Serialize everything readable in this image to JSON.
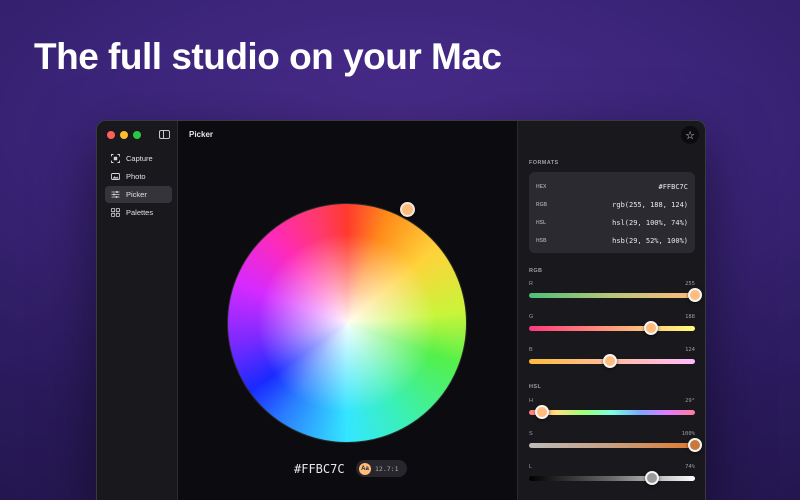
{
  "headline": "The full studio on your Mac",
  "sidebar": {
    "items": [
      {
        "label": "Capture",
        "icon": "capture-icon"
      },
      {
        "label": "Photo",
        "icon": "photo-icon"
      },
      {
        "label": "Picker",
        "icon": "sliders-icon",
        "active": true
      },
      {
        "label": "Palettes",
        "icon": "grid-icon"
      }
    ]
  },
  "main": {
    "title": "Picker",
    "hex": "#FFBC7C",
    "contrast_badge": "Aa",
    "contrast_ratio": "12.7:1",
    "selected_color": "#FFBC7C"
  },
  "panel": {
    "formats_label": "FORMATS",
    "formats": [
      {
        "key": "HEX",
        "value": "#FFBC7C"
      },
      {
        "key": "RGB",
        "value": "rgb(255, 188, 124)"
      },
      {
        "key": "HSL",
        "value": "hsl(29, 100%, 74%)"
      },
      {
        "key": "HSB",
        "value": "hsb(29, 52%, 100%)"
      }
    ],
    "rgb_label": "RGB",
    "rgb": [
      {
        "channel": "R",
        "value": "255",
        "fraction": 1.0
      },
      {
        "channel": "G",
        "value": "188",
        "fraction": 0.737
      },
      {
        "channel": "B",
        "value": "124",
        "fraction": 0.486
      }
    ],
    "hsl_label": "HSL",
    "hsl": [
      {
        "channel": "H",
        "value": "29°",
        "fraction": 0.081
      },
      {
        "channel": "S",
        "value": "100%",
        "fraction": 1.0
      },
      {
        "channel": "L",
        "value": "74%",
        "fraction": 0.74
      }
    ]
  },
  "colors": {
    "accent": "#FFBC7C",
    "window_bg": "#0C0C10",
    "sidebar_bg": "#19191D"
  }
}
